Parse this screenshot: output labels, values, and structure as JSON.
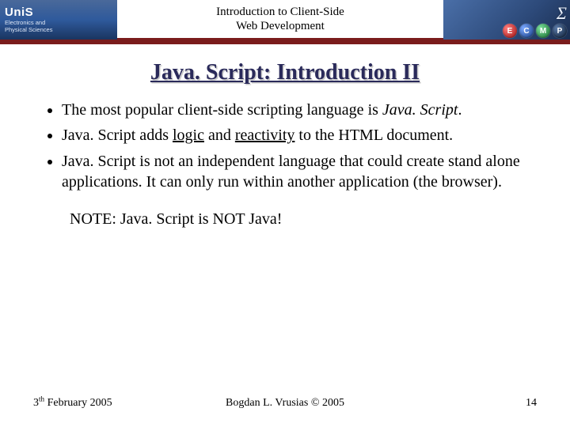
{
  "header": {
    "org": "UniS",
    "dept1": "Electronics and",
    "dept2": "Physical Sciences",
    "course1": "Introduction to Client-Side",
    "course2": "Web Development",
    "sigma": "Σ",
    "badges": [
      "E",
      "C",
      "M",
      "P"
    ]
  },
  "title": "Java. Script: Introduction II",
  "bullets": {
    "b1a": "The most popular client-side scripting language is ",
    "b1b": "Java. Script",
    "b1c": ".",
    "b2a": "Java. Script adds ",
    "b2b": "logic",
    "b2c": " and ",
    "b2d": "reactivity",
    "b2e": " to the HTML document.",
    "b3": "Java. Script is not an independent language that could create stand alone applications. It can only run within another application (the browser)."
  },
  "note": "NOTE: Java. Script is NOT Java!",
  "footer": {
    "date_pre": "3",
    "date_sup": "th",
    "date_post": " February 2005",
    "author": "Bogdan L. Vrusias © 2005",
    "page": "14"
  }
}
